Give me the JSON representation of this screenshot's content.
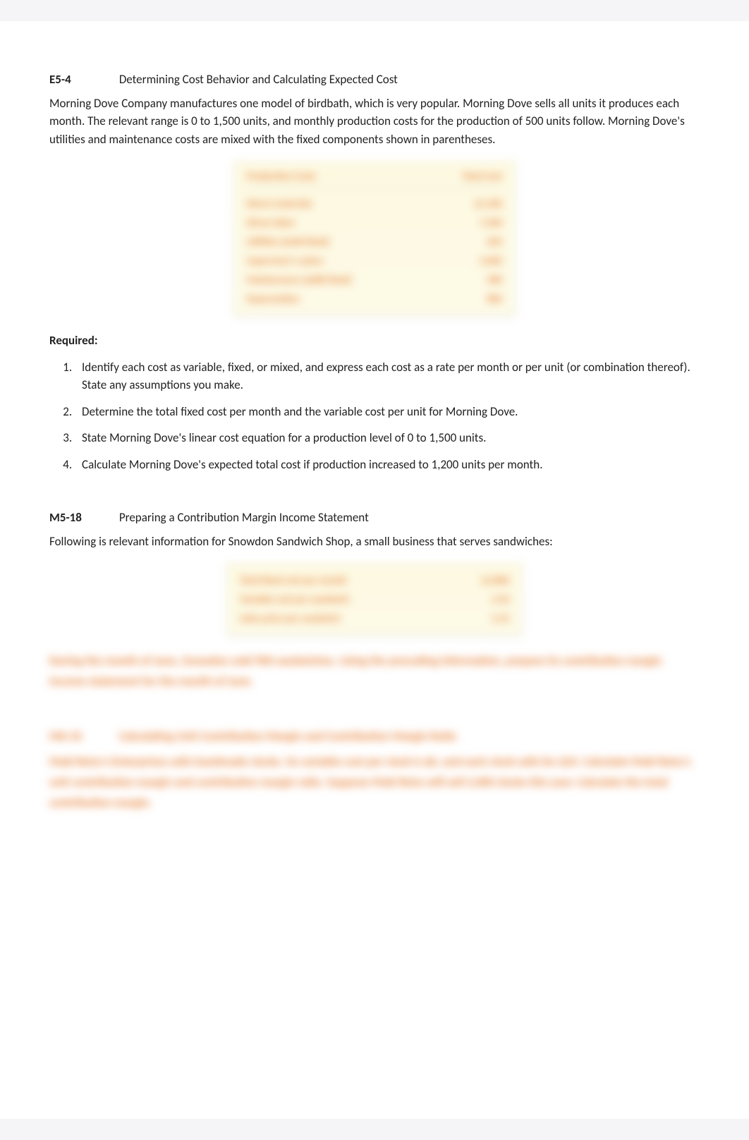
{
  "problems": [
    {
      "id": "E5-4",
      "title": "Determining Cost Behavior and Calculating Expected Cost",
      "description": "Morning Dove Company manufactures one model of birdbath, which is very popular. Morning Dove sells all units it produces each month. The relevant range is 0 to 1,500 units, and monthly production costs for the production of 500 units follow. Morning Dove's utilities and maintenance costs are mixed with the fixed components shown in parentheses.",
      "table": {
        "header_left": "Production Costs",
        "header_right": "Total Cost",
        "rows": [
          {
            "label": "Direct materials",
            "value": "$1,500"
          },
          {
            "label": "Direct labor",
            "value": "7,500"
          },
          {
            "label": "Utilities ($100 fixed)",
            "value": "650"
          },
          {
            "label": "Supervisor's salary",
            "value": "3,000"
          },
          {
            "label": "Maintenance ($280 fixed)",
            "value": "480"
          },
          {
            "label": "Depreciation",
            "value": "800"
          }
        ]
      },
      "required_label": "Required:",
      "required_items": [
        "Identify each cost as variable, fixed, or mixed, and express each cost as a rate per month or per unit (or combination thereof). State any assumptions you make.",
        "Determine the total fixed cost per month and the variable cost per unit for Morning Dove.",
        "State Morning Dove's linear cost equation for a production level of 0 to 1,500 units.",
        "Calculate Morning Dove's expected total cost if production increased to 1,200 units per month."
      ]
    },
    {
      "id": "M5-18",
      "title": "Preparing a Contribution Margin Income Statement",
      "description": "Following is relevant information for Snowdon Sandwich Shop, a small business that serves sandwiches:",
      "table": {
        "rows": [
          {
            "label": "Total fixed cost per month",
            "value": "$1,800"
          },
          {
            "label": "Variable cost per sandwich",
            "value": "2.50"
          },
          {
            "label": "Sales price per sandwich",
            "value": "5.25"
          }
        ]
      },
      "blurred_followup": "During the month of June, Snowdon sold 900 sandwiches.  Using the preceding information, prepare its contribution margin income statement for the month of June."
    },
    {
      "id": "M6-10",
      "title": "Calculating Unit Contribution Margin and Contribution Margin Ratio",
      "blurred_desc": "Matt Reiss's Enterprises sells handmade clocks. Its variable cost per clock is $6, and each clock sells for $24. Calculate Matt Reiss's unit contribution  margin and contribution margin ratio. Suppose Matt Reiss will sell 2,000 clocks this year. Calculate the total contribution margin."
    }
  ]
}
